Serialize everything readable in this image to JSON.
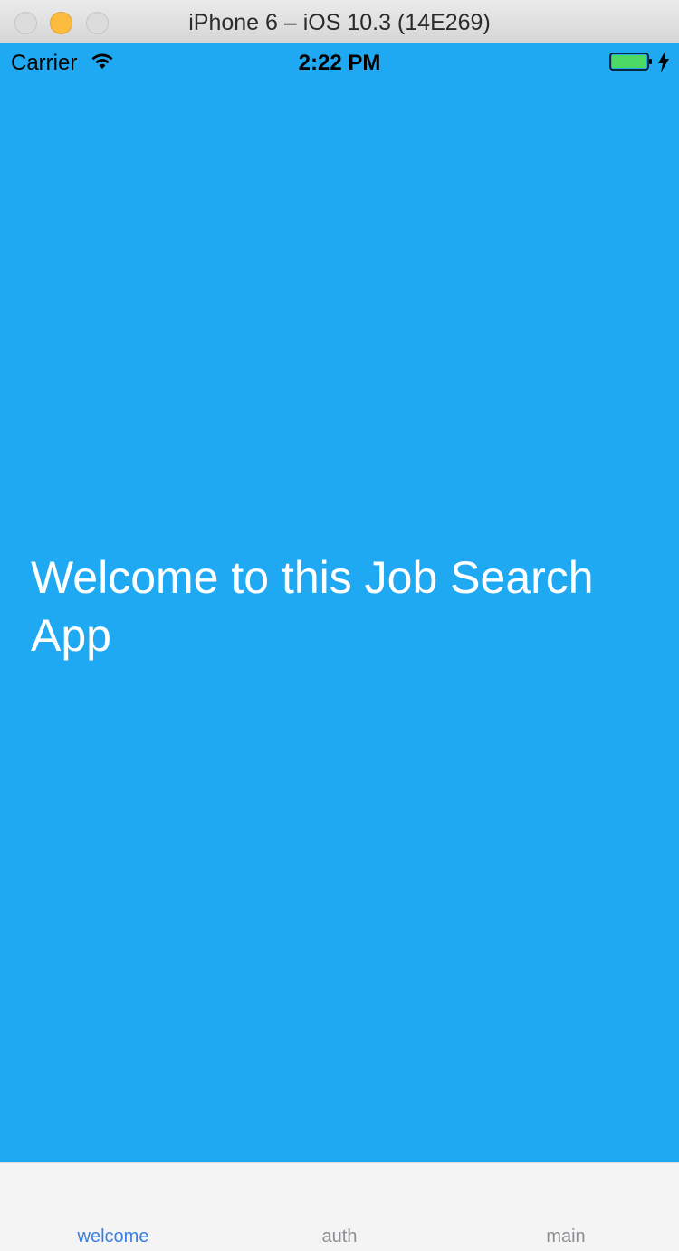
{
  "window": {
    "title": "iPhone 6 – iOS 10.3 (14E269)"
  },
  "status_bar": {
    "carrier": "Carrier",
    "time": "2:22 PM",
    "battery_color": "#4cd964"
  },
  "main": {
    "welcome_text": "Welcome to this Job Search App",
    "background_color": "#1fa9f2"
  },
  "tab_bar": {
    "tabs": [
      {
        "label": "welcome",
        "active": true
      },
      {
        "label": "auth",
        "active": false
      },
      {
        "label": "main",
        "active": false
      }
    ],
    "active_color": "#3b7fe0",
    "inactive_color": "#8e8e93"
  }
}
